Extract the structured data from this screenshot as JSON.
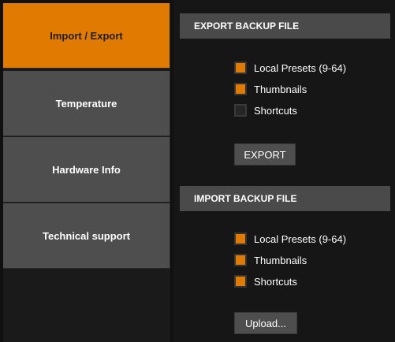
{
  "sidebar": {
    "items": [
      {
        "label": "Import / Export",
        "active": true
      },
      {
        "label": "Temperature",
        "active": false
      },
      {
        "label": "Hardware Info",
        "active": false
      },
      {
        "label": "Technical support",
        "active": false
      }
    ]
  },
  "export_section": {
    "title": "EXPORT BACKUP FILE",
    "options": [
      {
        "label": "Local Presets (9-64)",
        "checked": true
      },
      {
        "label": "Thumbnails",
        "checked": true
      },
      {
        "label": "Shortcuts",
        "checked": false
      }
    ],
    "button_label": "EXPORT"
  },
  "import_section": {
    "title": "IMPORT BACKUP FILE",
    "options": [
      {
        "label": "Local Presets (9-64)",
        "checked": true
      },
      {
        "label": "Thumbnails",
        "checked": true
      },
      {
        "label": "Shortcuts",
        "checked": true
      }
    ],
    "button_label": "Upload..."
  },
  "colors": {
    "accent": "#e07a00",
    "nav_inactive": "#4e4e4e",
    "background": "#161616"
  }
}
